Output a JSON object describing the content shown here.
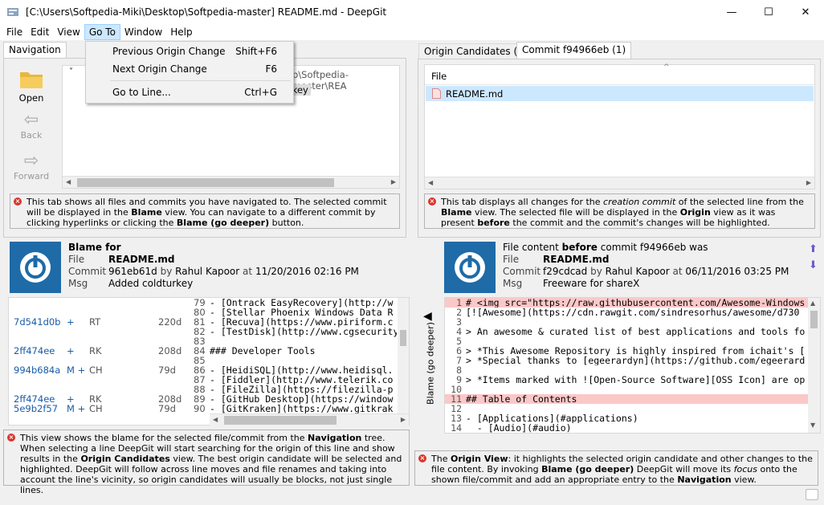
{
  "window": {
    "title": "[C:\\Users\\Softpedia-Miki\\Desktop\\Softpedia-master] README.md - DeepGit",
    "minimize": "—",
    "maximize": "☐",
    "close": "✕"
  },
  "menubar": {
    "file": "File",
    "edit": "Edit",
    "view": "View",
    "goto": "Go To",
    "window": "Window",
    "help": "Help"
  },
  "goto_menu": {
    "items": [
      {
        "label": "Previous Origin Change",
        "shortcut": "Shift+F6"
      },
      {
        "label": "Next Origin Change",
        "shortcut": "F6"
      },
      {
        "label": "Go to Line...",
        "shortcut": "Ctrl+G"
      }
    ]
  },
  "navigation": {
    "tab": "Navigation",
    "open": "Open",
    "back": "Back",
    "forward": "Forward",
    "tree_path": "p\\Softpedia-master\\REA",
    "tree_item": "rkey",
    "info": {
      "text": "This tab shows all files and commits you have navigated to. The selected commit will be displayed in the",
      "bold1": "Blame",
      "text2": "view. You can navigate to a different commit by clicking hyperlinks or clicking the",
      "bold2": "Blame (go deeper)",
      "text3": "button."
    }
  },
  "origin": {
    "tab1": "Origin Candidates (1)",
    "tab2": "Commit f94966eb (1)",
    "col_file": "File",
    "file": "README.md",
    "info": {
      "t1": "This tab displays all changes for the",
      "i1": "creation commit",
      "t2": "of the selected line from the",
      "b1": "Blame",
      "t3": "view. The selected file will be displayed in the",
      "b2": "Origin",
      "t4": "view as it was present",
      "b3": "before",
      "t5": "the commit and the commit's changes will be highlighted."
    }
  },
  "blame": {
    "heading": "Blame for",
    "file_label": "File",
    "file": "README.md",
    "commit_label": "Commit",
    "commit": "961eb61d",
    "by": "by",
    "author": "Rahul Kapoor",
    "at": "at",
    "date": "11/20/2016 02:16 PM",
    "msg_label": "Msg",
    "msg": "Added coldturkey",
    "rows": [
      {
        "hash": "",
        "flags": "",
        "auth": "",
        "age": "",
        "num": "79",
        "code": "- [Ontrack EasyRecovery](http://w"
      },
      {
        "hash": "",
        "flags": "",
        "auth": "",
        "age": "",
        "num": "80",
        "code": "- [Stellar Phoenix Windows Data R"
      },
      {
        "hash": "7d541d0b",
        "flags": "+",
        "auth": "RT",
        "age": "220d",
        "num": "81",
        "code": "- [Recuva](https://www.piriform.c"
      },
      {
        "hash": "",
        "flags": "",
        "auth": "",
        "age": "",
        "num": "82",
        "code": "- [TestDisk](http://www.cgsecurity"
      },
      {
        "hash": "",
        "flags": "",
        "auth": "",
        "age": "",
        "num": "83",
        "code": ""
      },
      {
        "hash": "2ff474ee",
        "flags": "+",
        "auth": "RK",
        "age": "208d",
        "num": "84",
        "code": "### Developer Tools"
      },
      {
        "hash": "",
        "flags": "",
        "auth": "",
        "age": "",
        "num": "85",
        "code": ""
      },
      {
        "hash": "994b684a",
        "flags": "M +",
        "auth": "CH",
        "age": "79d",
        "num": "86",
        "code": "- [HeidiSQL](http://www.heidisql."
      },
      {
        "hash": "",
        "flags": "",
        "auth": "",
        "age": "",
        "num": "87",
        "code": "- [Fiddler](http://www.telerik.co"
      },
      {
        "hash": "",
        "flags": "",
        "auth": "",
        "age": "",
        "num": "88",
        "code": "- [FileZilla](https://filezilla-p"
      },
      {
        "hash": "2ff474ee",
        "flags": "+",
        "auth": "RK",
        "age": "208d",
        "num": "89",
        "code": "- [GitHub Desktop](https://window"
      },
      {
        "hash": "5e9b2f57",
        "flags": "M +",
        "auth": "CH",
        "age": "79d",
        "num": "90",
        "code": "- [GitKraken](https://www.gitkrak"
      }
    ],
    "go_deeper": "Blame (go deeper)",
    "info": {
      "t1": "This view shows the blame for the selected file/commit from the",
      "b1": "Navigation",
      "t2": "tree. When selecting a line DeepGit will start searching for the origin of this line and show results in the",
      "b2": "Origin Candidates",
      "t3": "view. The best origin candidate will be selected and highlighted. DeepGit will follow across line moves and file renames and taking into account the line's vicinity, so origin candidates will usually be blocks, not just single lines."
    }
  },
  "originview": {
    "heading_pre": "File content",
    "heading_bold": "before",
    "heading_post": "commit f94966eb was",
    "file_label": "File",
    "file": "README.md",
    "commit_label": "Commit",
    "commit": "f29cdcad",
    "by": "by",
    "author": "Rahul Kapoor",
    "at": "at",
    "date": "06/11/2016 03:25 PM",
    "msg_label": "Msg",
    "msg": "Freeware for shareX",
    "lines": [
      {
        "num": "1",
        "code": "# <img src=\"https://raw.githubusercontent.com/Awesome-Windows",
        "hl": true
      },
      {
        "num": "2",
        "code": "[![Awesome](https://cdn.rawgit.com/sindresorhus/awesome/d730",
        "hl": false
      },
      {
        "num": "3",
        "code": "",
        "hl": false
      },
      {
        "num": "4",
        "code": "> An awesome & curated list of best applications and tools fo",
        "hl": false
      },
      {
        "num": "5",
        "code": "",
        "hl": false
      },
      {
        "num": "6",
        "code": "> *This Awesome Repository is highly inspired from ichait's [",
        "hl": false
      },
      {
        "num": "7",
        "code": "> *Special thanks to [egeerardyn](https://github.com/egeerard",
        "hl": false
      },
      {
        "num": "8",
        "code": "",
        "hl": false
      },
      {
        "num": "9",
        "code": "> *Items marked with ![Open-Source Software][OSS Icon] are op",
        "hl": false
      },
      {
        "num": "10",
        "code": "",
        "hl": false
      },
      {
        "num": "11",
        "code": "## Table of Contents",
        "hl": true
      },
      {
        "num": "12",
        "code": "",
        "hl": false
      },
      {
        "num": "13",
        "code": "- [Applications](#applications)",
        "hl": false
      },
      {
        "num": "14",
        "code": "  - [Audio](#audio)",
        "hl": false
      }
    ],
    "info": {
      "t0": "The",
      "b0": "Origin View",
      "t1": ": it highlights the selected origin candidate and other changes to the file content. By invoking",
      "b1": "Blame (go deeper)",
      "t2": "DeepGit will move its",
      "i1": "focus",
      "t3": "onto the shown file/commit and add an appropriate entry to the",
      "b2": "Navigation",
      "t4": "view."
    }
  },
  "colors": {
    "link": "#1a5ca8",
    "highlight_pink": "#fbc8c8",
    "selection": "#cce8ff",
    "accent": "#1e6ba8"
  }
}
